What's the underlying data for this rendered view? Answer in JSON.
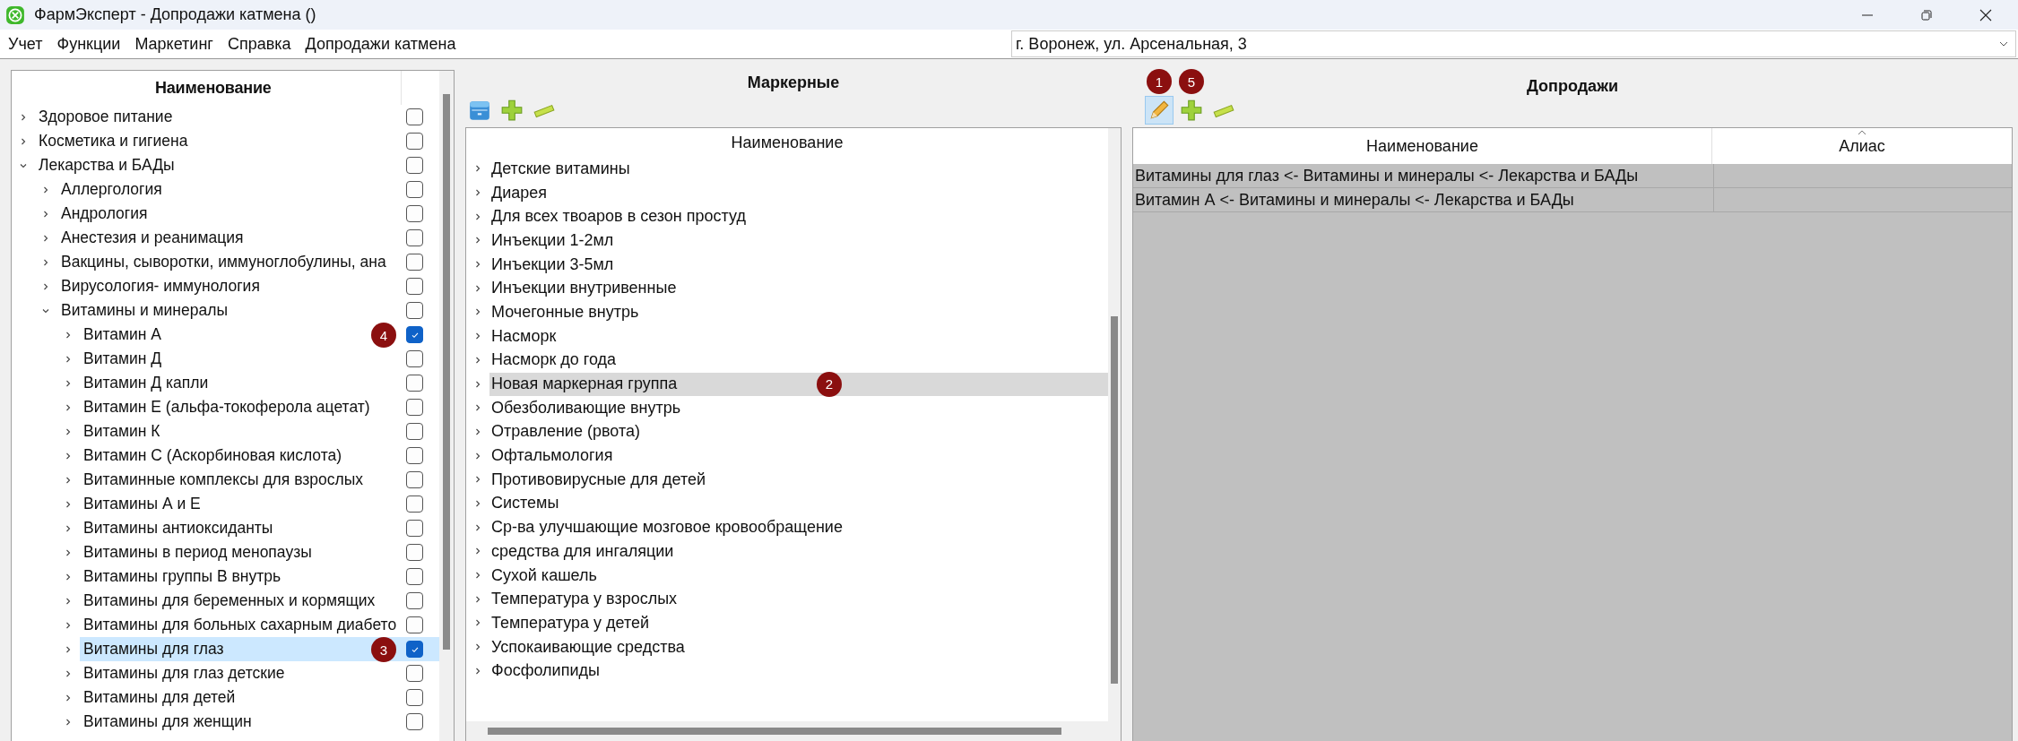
{
  "window": {
    "title": "ФармЭксперт - Допродажи катмена ()"
  },
  "menu": [
    "Учет",
    "Функции",
    "Маркетинг",
    "Справка",
    "Допродажи катмена"
  ],
  "address_select": {
    "value": "г. Воронеж, ул. Арсенальная, 3"
  },
  "categories": {
    "column": "Наименование",
    "items": [
      {
        "label": "Здоровое питание",
        "expanded": false,
        "checked": false,
        "selected": false
      },
      {
        "label": "Косметика и гигиена",
        "expanded": false,
        "checked": false,
        "selected": false
      },
      {
        "label": "Лекарства и БАДы",
        "expanded": true,
        "checked": false,
        "selected": false,
        "children": [
          {
            "label": "Аллергология",
            "expanded": false,
            "checked": false,
            "selected": false
          },
          {
            "label": "Андрология",
            "expanded": false,
            "checked": false,
            "selected": false
          },
          {
            "label": "Анестезия и реанимация",
            "expanded": false,
            "checked": false,
            "selected": false
          },
          {
            "label": "Вакцины, сыворотки, иммуноглобулины, ана",
            "expanded": false,
            "checked": false,
            "selected": false
          },
          {
            "label": "Вирусология- иммунология",
            "expanded": false,
            "checked": false,
            "selected": false
          },
          {
            "label": "Витамины и минералы",
            "expanded": true,
            "checked": false,
            "selected": false,
            "children": [
              {
                "label": "Витамин А",
                "expanded": false,
                "checked": true,
                "selected": false,
                "badge": "4"
              },
              {
                "label": "Витамин Д",
                "expanded": false,
                "checked": false,
                "selected": false
              },
              {
                "label": "Витамин Д капли",
                "expanded": false,
                "checked": false,
                "selected": false
              },
              {
                "label": "Витамин Е (альфа-токоферола ацетат)",
                "expanded": false,
                "checked": false,
                "selected": false
              },
              {
                "label": "Витамин К",
                "expanded": false,
                "checked": false,
                "selected": false
              },
              {
                "label": "Витамин С (Аскорбиновая кислота)",
                "expanded": false,
                "checked": false,
                "selected": false
              },
              {
                "label": "Витаминные комплексы для взрослых",
                "expanded": false,
                "checked": false,
                "selected": false
              },
              {
                "label": "Витамины А и Е",
                "expanded": false,
                "checked": false,
                "selected": false
              },
              {
                "label": "Витамины антиоксиданты",
                "expanded": false,
                "checked": false,
                "selected": false
              },
              {
                "label": "Витамины в период менопаузы",
                "expanded": false,
                "checked": false,
                "selected": false
              },
              {
                "label": "Витамины группы В внутрь",
                "expanded": false,
                "checked": false,
                "selected": false
              },
              {
                "label": "Витамины для беременных и кормящих",
                "expanded": false,
                "checked": false,
                "selected": false
              },
              {
                "label": "Витамины для больных сахарным диабето",
                "expanded": false,
                "checked": false,
                "selected": false
              },
              {
                "label": "Витамины для глаз",
                "expanded": false,
                "checked": true,
                "selected": true,
                "badge": "3"
              },
              {
                "label": "Витамины для глаз детские",
                "expanded": false,
                "checked": false,
                "selected": false
              },
              {
                "label": "Витамины для детей",
                "expanded": false,
                "checked": false,
                "selected": false
              },
              {
                "label": "Витамины для женщин",
                "expanded": false,
                "checked": false,
                "selected": false
              }
            ]
          }
        ]
      }
    ]
  },
  "markers": {
    "title": "Маркерные",
    "toolbar": [
      {
        "kind": "archive",
        "pressed": false
      },
      {
        "kind": "add",
        "pressed": false
      },
      {
        "kind": "remove",
        "pressed": false
      }
    ],
    "column": "Наименование",
    "items": [
      {
        "label": "Детские витамины",
        "expanded": false,
        "selected": false
      },
      {
        "label": "Диарея",
        "expanded": false,
        "selected": false
      },
      {
        "label": "Для всех твоаров в сезон простуд",
        "expanded": false,
        "selected": false
      },
      {
        "label": "Инъекции 1-2мл",
        "expanded": false,
        "selected": false
      },
      {
        "label": "Инъекции 3-5мл",
        "expanded": false,
        "selected": false
      },
      {
        "label": "Инъекции внутривенные",
        "expanded": false,
        "selected": false
      },
      {
        "label": "Мочегонные внутрь",
        "expanded": false,
        "selected": false
      },
      {
        "label": "Насморк",
        "expanded": false,
        "selected": false
      },
      {
        "label": "Насморк до года",
        "expanded": false,
        "selected": false
      },
      {
        "label": "Новая маркерная группа",
        "expanded": false,
        "selected": true,
        "badge": "2"
      },
      {
        "label": "Обезболивающие внутрь",
        "expanded": false,
        "selected": false
      },
      {
        "label": "Отравление (рвота)",
        "expanded": false,
        "selected": false
      },
      {
        "label": "Офтальмология",
        "expanded": false,
        "selected": false
      },
      {
        "label": "Противовирусные для детей",
        "expanded": false,
        "selected": false
      },
      {
        "label": "Системы",
        "expanded": false,
        "selected": false
      },
      {
        "label": "Ср-ва улучшающие мозговое кровообращение",
        "expanded": false,
        "selected": false
      },
      {
        "label": "средства для ингаляции",
        "expanded": false,
        "selected": false
      },
      {
        "label": "Сухой кашель",
        "expanded": false,
        "selected": false
      },
      {
        "label": "Температура у взрослых",
        "expanded": false,
        "selected": false
      },
      {
        "label": "Температура у детей",
        "expanded": false,
        "selected": false
      },
      {
        "label": "Успокаивающие средства",
        "expanded": false,
        "selected": false
      },
      {
        "label": "Фосфолипиды",
        "expanded": false,
        "selected": false
      }
    ]
  },
  "upsells": {
    "title": "Допродажи",
    "toolbar": [
      {
        "kind": "edit",
        "pressed": true,
        "badge": "1"
      },
      {
        "kind": "add",
        "pressed": false,
        "badge": "5"
      },
      {
        "kind": "remove",
        "pressed": false
      }
    ],
    "columns": [
      "Наименование",
      "Алиас"
    ],
    "rows": [
      {
        "name": "Витамины для глаз <- Витамины и минералы <- Лекарства и БАДы"
      },
      {
        "name": "Витамин А  <- Витамины и минералы <- Лекарства и БАДы"
      }
    ]
  }
}
